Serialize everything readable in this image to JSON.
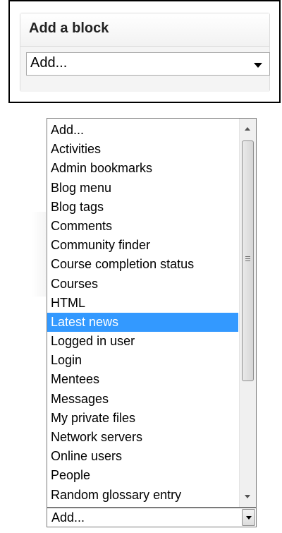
{
  "block": {
    "title": "Add a block",
    "select_value": "Add..."
  },
  "dropdown": {
    "options": [
      "Add...",
      "Activities",
      "Admin bookmarks",
      "Blog menu",
      "Blog tags",
      "Comments",
      "Community finder",
      "Course completion status",
      "Courses",
      "HTML",
      "Latest news",
      "Logged in user",
      "Login",
      "Mentees",
      "Messages",
      "My private files",
      "Network servers",
      "Online users",
      "People",
      "Random glossary entry"
    ],
    "highlighted": "Latest news",
    "select_value": "Add..."
  },
  "icons": {
    "block_select_arrow": "chevron-down-icon",
    "scroll_up": "scroll-up-arrow-icon",
    "scroll_down": "scroll-down-arrow-icon",
    "scroll_grip": "grip-lines-icon",
    "bottom_select_arrow": "chevron-down-icon"
  },
  "colors": {
    "highlight": "#3399ff",
    "highlight_text": "#ffffff"
  }
}
